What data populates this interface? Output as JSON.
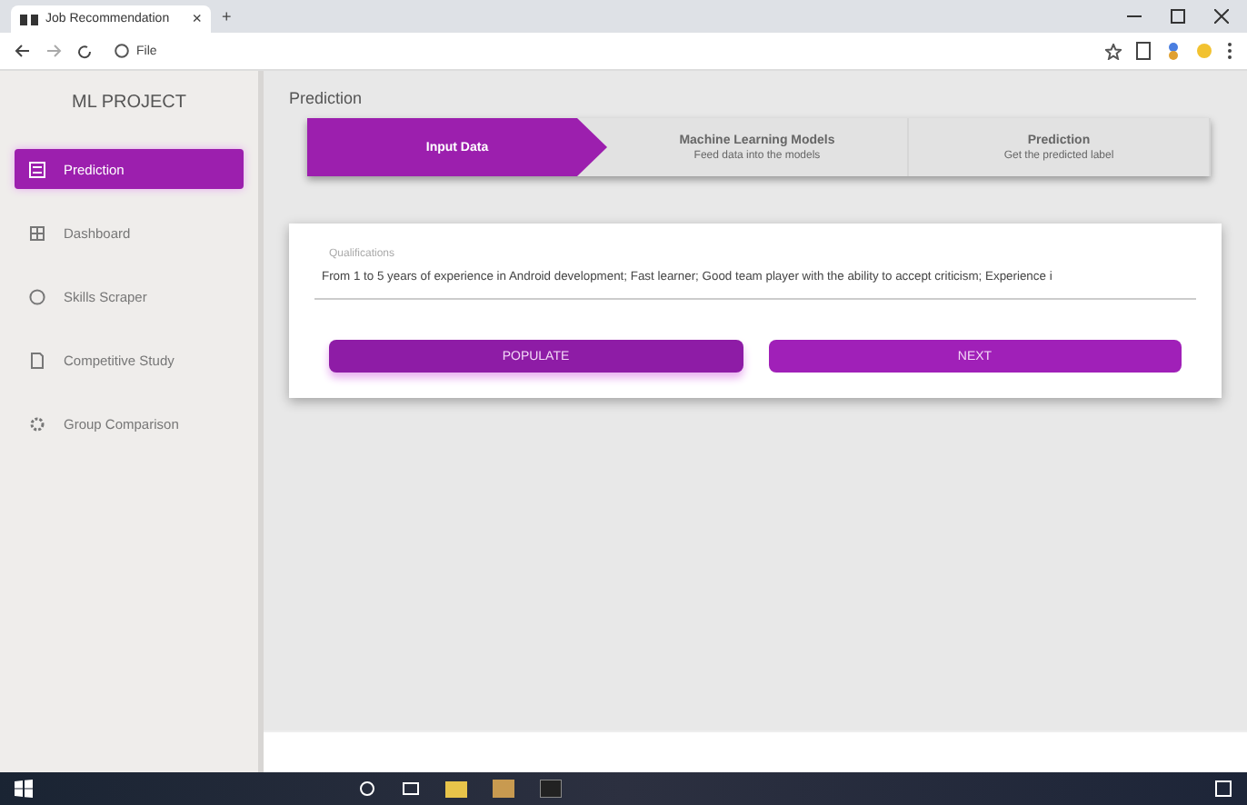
{
  "browser": {
    "tab_title": "Job Recommendation",
    "tab_close": "×",
    "new_tab": "+",
    "address_prefix": "File"
  },
  "sidebar": {
    "title": "ML PROJECT",
    "items": [
      {
        "label": "Prediction",
        "selected": true
      },
      {
        "label": "Dashboard",
        "selected": false
      },
      {
        "label": "Skills Scraper",
        "selected": false
      },
      {
        "label": "Competitive Study",
        "selected": false
      },
      {
        "label": "Group Comparison",
        "selected": false
      }
    ]
  },
  "page": {
    "title": "Prediction"
  },
  "steps": [
    {
      "title": "Input Data",
      "selected": true
    },
    {
      "title": "Machine Learning Models",
      "subtitle": "Feed data into the models",
      "selected": false
    },
    {
      "title": "Prediction",
      "subtitle": "Get the predicted label",
      "selected": false
    }
  ],
  "form": {
    "label": "Qualifications",
    "value": "From 1 to 5 years of experience in Android development; Fast learner; Good team player with the ability to accept criticism; Experience i"
  },
  "buttons": [
    "POPULATE",
    "NEXT"
  ]
}
